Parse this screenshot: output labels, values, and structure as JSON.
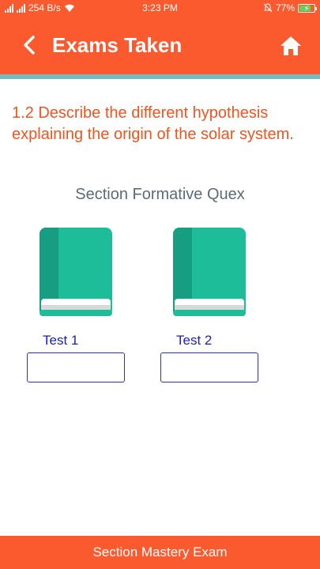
{
  "status_bar": {
    "network_speed": "254 B/s",
    "time": "3:23 PM",
    "battery_percent": "77%",
    "battery_level": 0.77
  },
  "app_bar": {
    "title": "Exams Taken",
    "back_icon": "chevron-left-icon",
    "home_icon": "home-icon"
  },
  "question": "1.2 Describe the different hypothesis explaining the origin of the solar system.",
  "section_title": "Section Formative Quex",
  "tests": [
    {
      "label": "Test  1",
      "value": "",
      "icon": "book-icon"
    },
    {
      "label": "Test  2",
      "value": "",
      "icon": "book-icon"
    }
  ],
  "bottom_button": "Section Mastery Exam",
  "colors": {
    "primary": "#fb5a2e",
    "accent_strip": "#7ab8c4",
    "question_text": "#f2541f",
    "section_text": "#5c6b79",
    "test_label": "#1a1fb3",
    "book_cover": "#1dbd9a",
    "book_spine": "#179e82"
  }
}
